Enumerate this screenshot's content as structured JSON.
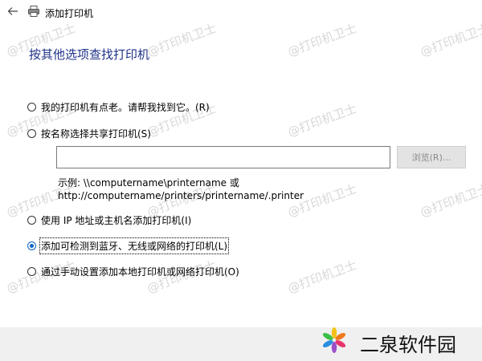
{
  "window": {
    "title": "添加打印机"
  },
  "heading": "按其他选项查找打印机",
  "options": [
    {
      "label": "我的打印机有点老。请帮我找到它。(R)",
      "checked": false
    },
    {
      "label": "按名称选择共享打印机(S)",
      "checked": false
    },
    {
      "label": "使用 IP 地址或主机名添加打印机(I)",
      "checked": false
    },
    {
      "label": "添加可检测到蓝牙、无线或网络的打印机(L)",
      "checked": true
    },
    {
      "label": "通过手动设置添加本地打印机或网络打印机(O)",
      "checked": false
    }
  ],
  "share_input": {
    "value": ""
  },
  "browse_label": "浏览(R)...",
  "example": {
    "line1": "示例: \\\\computername\\printername 或",
    "line2": "http://computername/printers/printername/.printer"
  },
  "watermark": "@打印机卫士",
  "brand": {
    "name": "二泉软件园"
  }
}
